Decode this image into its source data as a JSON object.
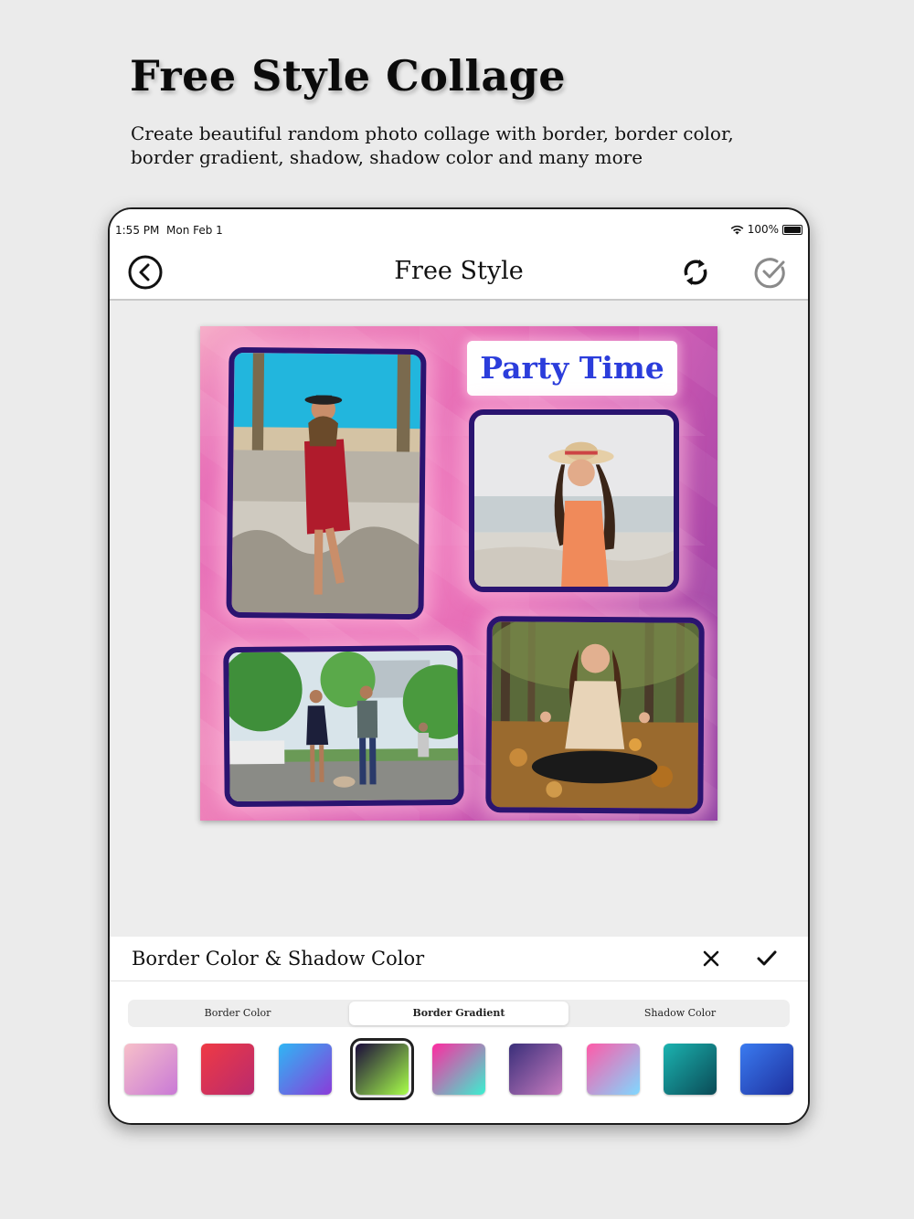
{
  "promo": {
    "headline": "Free Style Collage",
    "subline": "Create beautiful random photo collage with border, border color, border gradient, shadow, shadow color and many more"
  },
  "statusbar": {
    "time": "1:55 PM",
    "date": "Mon Feb 1",
    "battery": "100%"
  },
  "navbar": {
    "title": "Free Style",
    "back_icon": "back-circle-icon",
    "refresh_icon": "refresh-icon",
    "done_icon": "check-circle-icon"
  },
  "collage": {
    "label": "Party Time",
    "photos": [
      "photo-woman-red-dress",
      "photo-woman-hat-beach",
      "photo-couple-walking-dog",
      "photo-woman-autumn-leaves"
    ]
  },
  "panel": {
    "title": "Border Color & Shadow Color",
    "tabs": [
      {
        "label": "Border Color",
        "active": false
      },
      {
        "label": "Border Gradient",
        "active": true
      },
      {
        "label": "Shadow Color",
        "active": false
      }
    ],
    "selected_swatch": 3,
    "swatches": [
      [
        "#f7c0c9",
        "#c979d6"
      ],
      [
        "#ef3a44",
        "#b92a6e"
      ],
      [
        "#2fb6f4",
        "#8a3bd9"
      ],
      [
        "#1a0a3a",
        "#a8ff4a"
      ],
      [
        "#ff2aa0",
        "#3af0d0"
      ],
      [
        "#3a2f7a",
        "#c77bbf"
      ],
      [
        "#ff5aa8",
        "#7fd8ff"
      ],
      [
        "#1bb3b0",
        "#0a4a56"
      ],
      [
        "#3a7bf0",
        "#1e2f9e"
      ]
    ]
  },
  "colors": {
    "border": "#2a1470",
    "label_text": "#2b3ddb",
    "background": "#ebebeb"
  }
}
